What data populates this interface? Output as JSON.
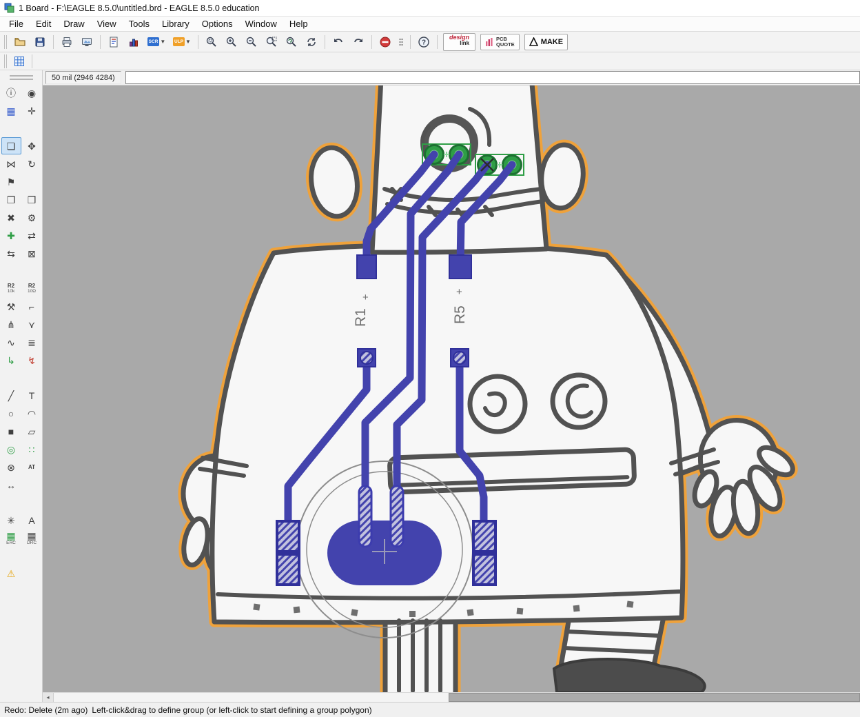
{
  "window": {
    "title": "1 Board - F:\\EAGLE 8.5.0\\untitled.brd - EAGLE 8.5.0 education"
  },
  "menu": {
    "items": [
      "File",
      "Edit",
      "Draw",
      "View",
      "Tools",
      "Library",
      "Options",
      "Window",
      "Help"
    ]
  },
  "toolbar": {
    "scr_badge": "SCR",
    "ulp_badge": "ULP",
    "design_link_top": "design",
    "design_link_bottom": "link",
    "pcb_quote_line1": "PCB",
    "pcb_quote_line2": "QUOTE",
    "make_label": "MAKE"
  },
  "command": {
    "coords": "50 mil (2946 4284)",
    "input_value": ""
  },
  "sidebar": {
    "tools": [
      {
        "name": "info",
        "glyph": "ⓘ"
      },
      {
        "name": "show",
        "glyph": "◉"
      },
      {
        "name": "display-layers",
        "glyph": "▦",
        "color": "#3a5fcd"
      },
      {
        "name": "mark",
        "glyph": "✛"
      },
      {
        "gap": true
      },
      {
        "name": "group",
        "glyph": "❏",
        "selected": true
      },
      {
        "name": "move",
        "glyph": "✥"
      },
      {
        "name": "mirror",
        "glyph": "⋈"
      },
      {
        "name": "rotate",
        "glyph": "↻"
      },
      {
        "name": "name",
        "glyph": "⚑"
      },
      {
        "name": "",
        "glyph": ""
      },
      {
        "name": "copy",
        "glyph": "❐"
      },
      {
        "name": "paste",
        "glyph": "❒"
      },
      {
        "name": "delete",
        "glyph": "✖"
      },
      {
        "name": "change",
        "glyph": "⚙"
      },
      {
        "name": "add",
        "glyph": "✚",
        "color": "#2f9e46"
      },
      {
        "name": "replace",
        "glyph": "⇄"
      },
      {
        "name": "pinswap",
        "glyph": "⇆"
      },
      {
        "name": "lock",
        "glyph": "⊠"
      },
      {
        "gap": true
      },
      {
        "name": "name-tag",
        "glyph": "R2",
        "label": "10k",
        "tiny": true
      },
      {
        "name": "value-tag",
        "glyph": "R2",
        "label": "10Ω",
        "tiny": true
      },
      {
        "name": "smash",
        "glyph": "⚒"
      },
      {
        "name": "miter",
        "glyph": "⌐"
      },
      {
        "name": "split",
        "glyph": "⋔"
      },
      {
        "name": "optimize",
        "glyph": "⋎"
      },
      {
        "name": "meander",
        "glyph": "∿"
      },
      {
        "name": "align",
        "glyph": "≣"
      },
      {
        "name": "route",
        "glyph": "↳",
        "color": "#2f9e46"
      },
      {
        "name": "ripup",
        "glyph": "↯",
        "color": "#c0392b"
      },
      {
        "gap": true
      },
      {
        "name": "wire",
        "glyph": "╱"
      },
      {
        "name": "text",
        "glyph": "T"
      },
      {
        "name": "circle",
        "glyph": "○"
      },
      {
        "name": "arc",
        "glyph": "◠"
      },
      {
        "name": "rect",
        "glyph": "■"
      },
      {
        "name": "polygon",
        "glyph": "▱"
      },
      {
        "name": "via",
        "glyph": "◎",
        "color": "#2f9e46"
      },
      {
        "name": "smd",
        "glyph": "∷",
        "color": "#2f9e46"
      },
      {
        "name": "hole",
        "glyph": "⊗"
      },
      {
        "name": "attribute",
        "glyph": "AT",
        "tiny": true
      },
      {
        "name": "signal",
        "glyph": "↔"
      },
      {
        "name": "",
        "glyph": ""
      },
      {
        "gap": true
      },
      {
        "name": "ratsnest",
        "glyph": "✳"
      },
      {
        "name": "autoroute",
        "glyph": "A"
      },
      {
        "name": "erc",
        "glyph": "▦",
        "label": "ERC",
        "color": "#2f9e46"
      },
      {
        "name": "drc",
        "glyph": "▦",
        "label": "DRC",
        "color": "#4a4a4a"
      },
      {
        "gap": true
      },
      {
        "name": "errors",
        "glyph": "⚠",
        "color": "#e6a817"
      },
      {
        "name": "",
        "glyph": ""
      }
    ]
  },
  "canvas": {
    "labels": {
      "r1": "R1",
      "r5": "R5"
    }
  },
  "status": {
    "redo": "Redo: Delete (2m ago)",
    "hint": "Left-click&drag to define group (or left-click to start defining a group polygon)"
  }
}
